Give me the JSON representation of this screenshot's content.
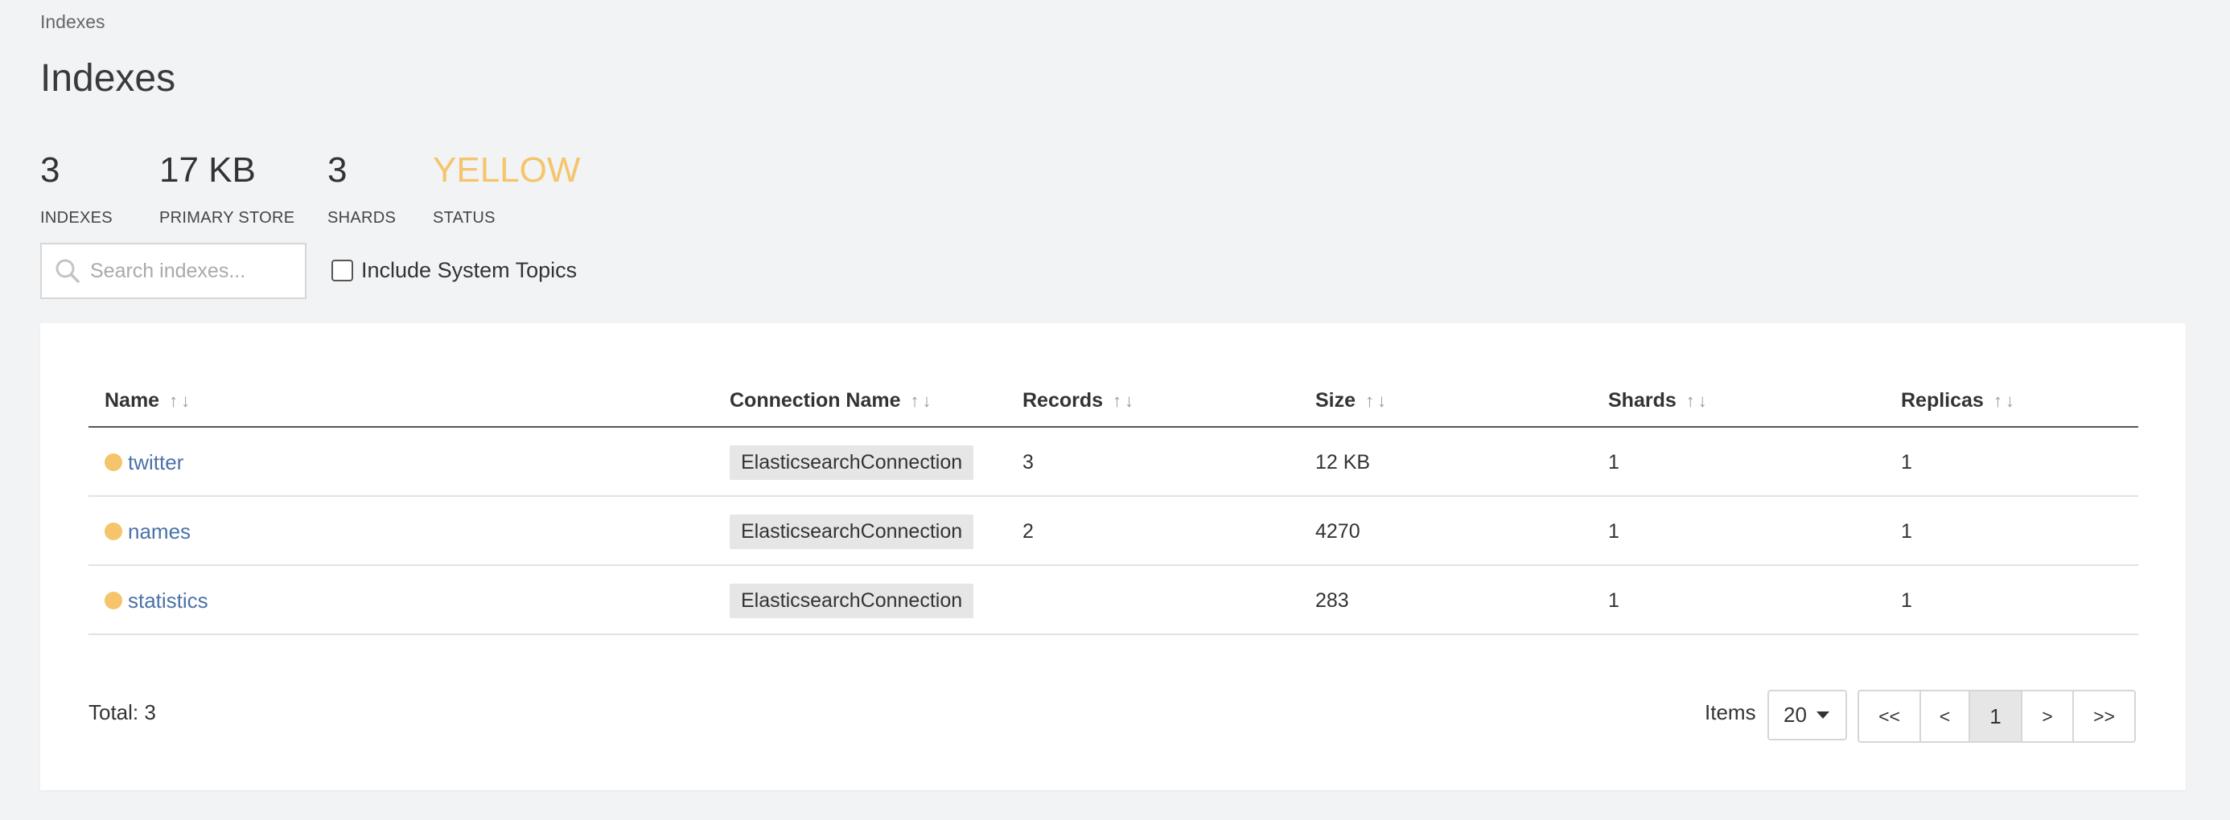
{
  "breadcrumb": "Indexes",
  "title": "Indexes",
  "stats": [
    {
      "value": "3",
      "label": "INDEXES"
    },
    {
      "value": "17 KB",
      "label": "PRIMARY STORE"
    },
    {
      "value": "3",
      "label": "SHARDS"
    },
    {
      "value": "YELLOW",
      "label": "STATUS"
    }
  ],
  "status_color": "#f5c46b",
  "search": {
    "placeholder": "Search indexes...",
    "value": ""
  },
  "include_system": {
    "label": "Include System Topics",
    "checked": false
  },
  "table": {
    "columns": [
      "Name",
      "Connection Name",
      "Records",
      "Size",
      "Shards",
      "Replicas"
    ],
    "sort_icons": {
      "up": "↑",
      "down": "↓"
    },
    "rows": [
      {
        "name": "twitter",
        "connection": "ElasticsearchConnection",
        "records": "3",
        "size": "12 KB",
        "shards": "1",
        "replicas": "1"
      },
      {
        "name": "names",
        "connection": "ElasticsearchConnection",
        "records": "2",
        "size": "4270",
        "shards": "1",
        "replicas": "1"
      },
      {
        "name": "statistics",
        "connection": "ElasticsearchConnection",
        "records": "",
        "size": "283",
        "shards": "1",
        "replicas": "1"
      }
    ]
  },
  "footer": {
    "total": "Total: 3",
    "items_label": "Items",
    "page_size": "20",
    "pager": {
      "first": "<<",
      "prev": "<",
      "current": "1",
      "next": ">",
      "last": ">>"
    }
  }
}
